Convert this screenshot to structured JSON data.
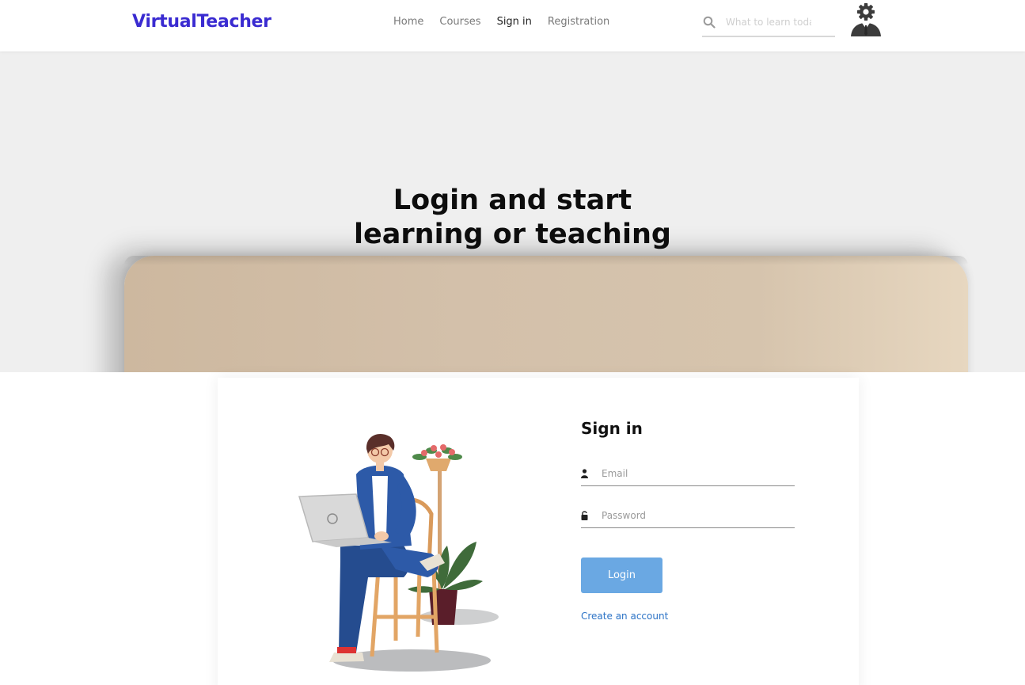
{
  "brand": {
    "name": "VirtualTeacher",
    "color": "#3a2bd1"
  },
  "nav": {
    "items": [
      {
        "label": "Home",
        "active": false
      },
      {
        "label": "Courses",
        "active": false
      },
      {
        "label": "Sign in",
        "active": true
      },
      {
        "label": "Registration",
        "active": false
      }
    ]
  },
  "search": {
    "placeholder": "What to learn today?",
    "value": "",
    "icon": "search-icon"
  },
  "user_menu": {
    "icon": "user-settings-avatar-icon"
  },
  "hero": {
    "title_line1": "Login and start",
    "title_line2": "learning or teaching"
  },
  "signin": {
    "title": "Sign in",
    "email": {
      "placeholder": "Email",
      "value": "",
      "icon": "user-icon"
    },
    "password": {
      "placeholder": "Password",
      "value": "",
      "icon": "lock-icon"
    },
    "login_label": "Login",
    "create_account_label": "Create an account"
  },
  "colors": {
    "accent_button": "#6aa8e3",
    "link": "#2c73c6",
    "hero_bg": "#efefef"
  }
}
